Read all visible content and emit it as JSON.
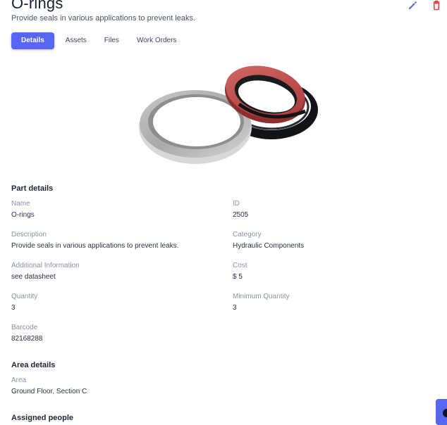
{
  "header": {
    "title": "O-rings",
    "subtitle": "Provide seals in various applications to prevent leaks.",
    "edit_icon": "pencil-icon",
    "delete_icon": "trash-icon",
    "accent_color": "#5766f4",
    "delete_color": "#e53935"
  },
  "tabs": [
    {
      "label": "Details",
      "active": true
    },
    {
      "label": "Assets",
      "active": false
    },
    {
      "label": "Files",
      "active": false
    },
    {
      "label": "Work Orders",
      "active": false
    }
  ],
  "part_details": {
    "heading": "Part details",
    "name": {
      "label": "Name",
      "value": "O-rings"
    },
    "id": {
      "label": "ID",
      "value": "2505"
    },
    "description": {
      "label": "Description",
      "value": "Provide seals in various applications to prevent leaks."
    },
    "category": {
      "label": "Category",
      "value": "Hydraulic Components"
    },
    "additional_info": {
      "label": "Additional Information",
      "value": "see datasheet"
    },
    "cost": {
      "label": "Cost",
      "value": "$ 5"
    },
    "quantity": {
      "label": "Quantity",
      "value": "3"
    },
    "min_quantity": {
      "label": "Minimum Quantity",
      "value": "3"
    },
    "barcode": {
      "label": "Barcode",
      "value": "82168288"
    }
  },
  "area_details": {
    "heading": "Area details",
    "area": {
      "label": "Area",
      "value": "Ground Floor, Section C"
    }
  },
  "assigned_people": {
    "heading": "Assigned people"
  }
}
